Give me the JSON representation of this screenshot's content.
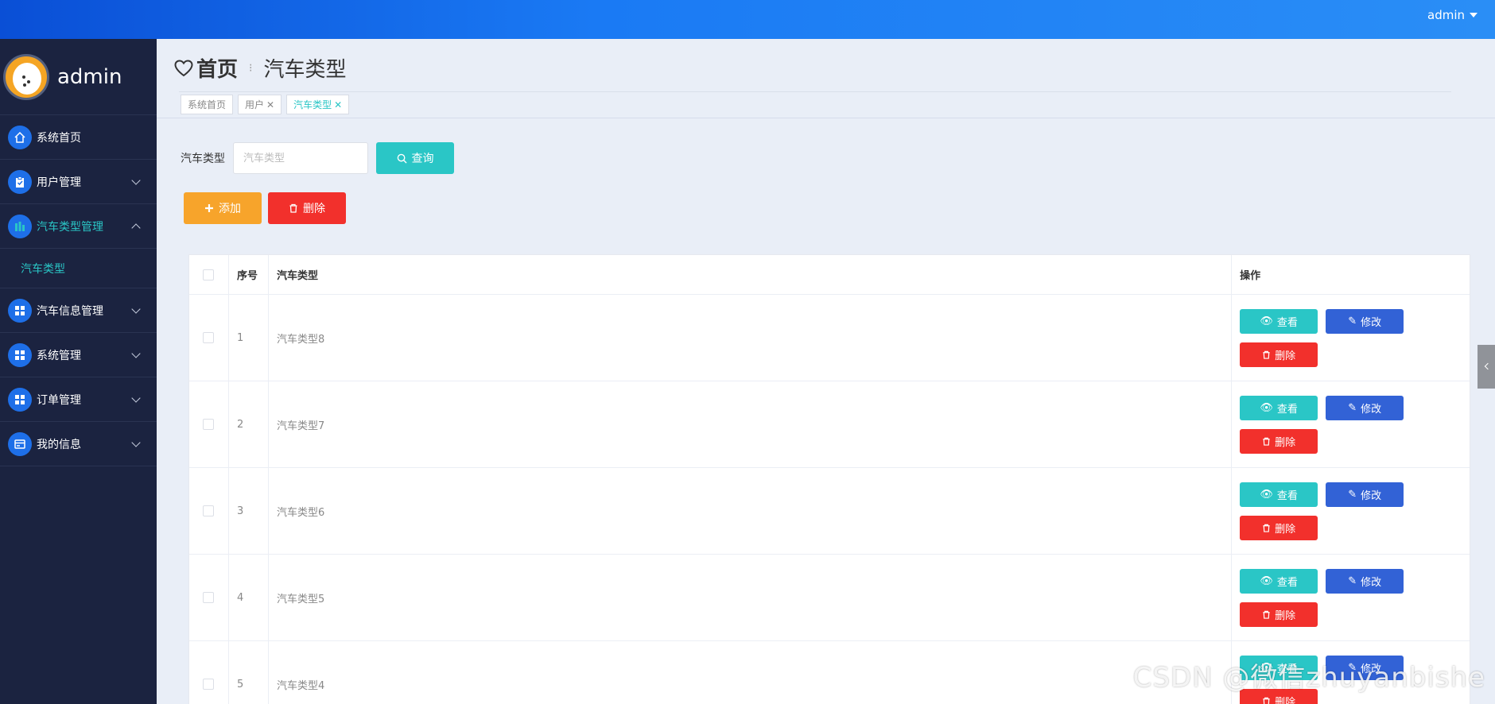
{
  "header": {
    "user": "admin"
  },
  "sidebar": {
    "profile_name": "admin",
    "items": [
      {
        "label": "系统首页",
        "icon": "home-icon",
        "expandable": false
      },
      {
        "label": "用户管理",
        "icon": "clipboard-icon",
        "expandable": true
      },
      {
        "label": "汽车类型管理",
        "icon": "chart-icon",
        "expandable": true,
        "active": true
      },
      {
        "label": "汽车信息管理",
        "icon": "grid-icon",
        "expandable": true
      },
      {
        "label": "系统管理",
        "icon": "grid-icon",
        "expandable": true
      },
      {
        "label": "订单管理",
        "icon": "grid-icon",
        "expandable": true
      },
      {
        "label": "我的信息",
        "icon": "card-icon",
        "expandable": true
      }
    ],
    "submenu": {
      "label": "汽车类型"
    }
  },
  "breadcrumb": {
    "home": "首页",
    "current": "汽车类型"
  },
  "tags": [
    {
      "label": "系统首页"
    },
    {
      "label": "用户"
    },
    {
      "label": "汽车类型"
    }
  ],
  "search": {
    "label": "汽车类型",
    "placeholder": "汽车类型",
    "button": "查询"
  },
  "toolbar": {
    "add_label": "添加",
    "delete_label": "删除"
  },
  "table": {
    "headers": {
      "index": "序号",
      "type": "汽车类型",
      "ops": "操作"
    },
    "rows": [
      {
        "index": "1",
        "type": "汽车类型8"
      },
      {
        "index": "2",
        "type": "汽车类型7"
      },
      {
        "index": "3",
        "type": "汽车类型6"
      },
      {
        "index": "4",
        "type": "汽车类型5"
      },
      {
        "index": "5",
        "type": "汽车类型4"
      }
    ],
    "actions": {
      "view": "查看",
      "edit": "修改",
      "delete": "删除"
    }
  },
  "watermark": "CSDN @微信zhuyanbishe",
  "colors": {
    "accent": "#2ac6c6",
    "sidebar": "#1b2340",
    "danger": "#f2302c",
    "warning": "#f7a42b",
    "primary": "#3262d6"
  }
}
